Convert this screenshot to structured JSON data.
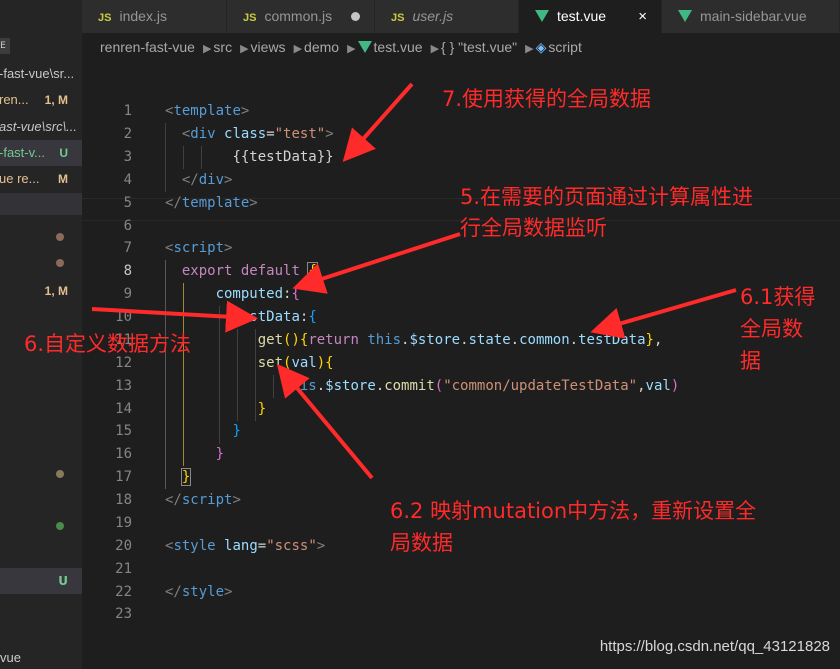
{
  "tabs": [
    {
      "label": "index.js",
      "type": "JS",
      "italic": false,
      "dirty": false,
      "active": false
    },
    {
      "label": "common.js",
      "type": "JS",
      "italic": false,
      "dirty": true,
      "active": false
    },
    {
      "label": "user.js",
      "type": "JS",
      "italic": true,
      "dirty": false,
      "active": false
    },
    {
      "label": "test.vue",
      "type": "vue",
      "italic": false,
      "dirty": false,
      "active": true,
      "close_icon": "×"
    },
    {
      "label": "main-sidebar.vue",
      "type": "vue",
      "italic": false,
      "dirty": false,
      "active": false
    }
  ],
  "breadcrumb": {
    "items": [
      "renren-fast-vue",
      "src",
      "views",
      "demo"
    ],
    "file": "test.vue",
    "object": "{ } \"test.vue\"",
    "symbol": "script"
  },
  "sidebar": {
    "pill": "E",
    "rows": [
      {
        "name": "-fast-vue\\sr...",
        "status": ""
      },
      {
        "name": "ren...",
        "status": "1, M"
      },
      {
        "name": "ast-vue\\src\\...",
        "status": ""
      },
      {
        "name": "-fast-v...",
        "status": "U"
      },
      {
        "name": "ue  re...",
        "status": "M"
      }
    ],
    "m_badge": "1, M",
    "u_badge": "U",
    "bottom_label": "vue"
  },
  "editor": {
    "line_numbers": [
      "1",
      "2",
      "3",
      "4",
      "5",
      "6",
      "7",
      "8",
      "9",
      "10",
      "11",
      "12",
      "13",
      "14",
      "15",
      "16",
      "17",
      "18",
      "19",
      "20",
      "21",
      "22",
      "23"
    ],
    "current_line": "8"
  },
  "annotations": {
    "a7": "7.使用获得的全局数据",
    "a5_line1": "5.在需要的页面通过计算属性进",
    "a5_line2": "行全局数据监听",
    "a61_line1": "6.1获得",
    "a61_line2": "全局数",
    "a61_line3": "据",
    "a6": "6.自定义数据方法",
    "a62_line1": "6.2 映射mutation中方法，重新设置全",
    "a62_line2": "局数据"
  },
  "watermark": "https://blog.csdn.net/qq_43121828",
  "colors": {
    "annotation": "#ff2a2a",
    "vue_green": "#41b883",
    "js_yellow": "#cbcb41"
  }
}
